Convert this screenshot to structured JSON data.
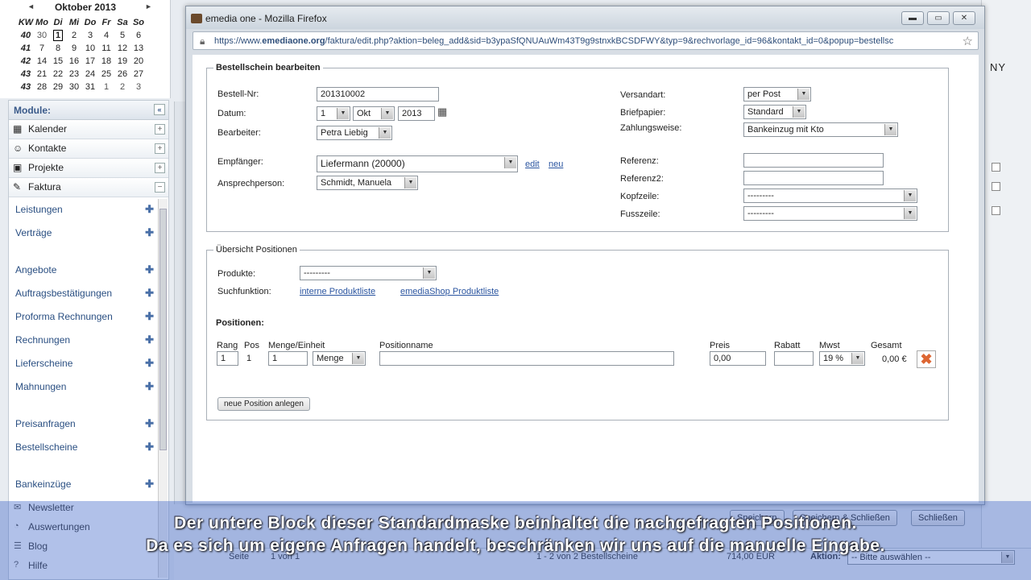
{
  "calendar": {
    "month_label": "Oktober 2013",
    "prev": "◄",
    "next": "►",
    "headers": [
      "KW",
      "Mo",
      "Di",
      "Mi",
      "Do",
      "Fr",
      "Sa",
      "So"
    ],
    "weeks": [
      [
        "40",
        "30",
        "1",
        "2",
        "3",
        "4",
        "5",
        "6"
      ],
      [
        "41",
        "7",
        "8",
        "9",
        "10",
        "11",
        "12",
        "13"
      ],
      [
        "42",
        "14",
        "15",
        "16",
        "17",
        "18",
        "19",
        "20"
      ],
      [
        "43",
        "21",
        "22",
        "23",
        "24",
        "25",
        "26",
        "27"
      ],
      [
        "43",
        "28",
        "29",
        "30",
        "31",
        "1",
        "2",
        "3"
      ]
    ]
  },
  "sidebar": {
    "header": "Module:",
    "collapse": "«",
    "modules": [
      {
        "label": "Kalender",
        "icon": "calendar-icon",
        "toggle": "+"
      },
      {
        "label": "Kontakte",
        "icon": "contacts-icon",
        "toggle": "+"
      },
      {
        "label": "Projekte",
        "icon": "projects-icon",
        "toggle": "+"
      },
      {
        "label": "Faktura",
        "icon": "invoice-icon",
        "toggle": "−"
      }
    ],
    "faktura_items": [
      "Leistungen",
      "Verträge",
      "Angebote",
      "Auftragsbestätigungen",
      "Proforma Rechnungen",
      "Rechnungen",
      "Lieferscheine",
      "Mahnungen",
      "Preisanfragen",
      "Bestellscheine",
      "Bankeinzüge"
    ],
    "lower_items": [
      "Newsletter",
      "Auswertungen",
      "Blog",
      "Hilfe"
    ]
  },
  "browser": {
    "title": "emedia one - Mozilla Firefox",
    "url_prefix": "https://www.",
    "url_domain": "emediaone.org",
    "url_path": "/faktura/edit.php?aktion=beleg_add&sid=b3ypaSfQNUAuWm43T9g9stnxkBCSDFWY&typ=9&rechvorlage_id=96&kontakt_id=0&popup=bestellsc",
    "win_buttons": [
      "▬",
      "▭",
      "✕"
    ]
  },
  "form": {
    "legend": "Bestellschein bearbeiten",
    "bestell_nr_label": "Bestell-Nr:",
    "bestell_nr": "201310002",
    "datum_label": "Datum:",
    "datum_day": "1",
    "datum_month": "Okt",
    "datum_year": "2013",
    "bearbeiter_label": "Bearbeiter:",
    "bearbeiter": "Petra Liebig",
    "empfaenger_label": "Empfänger:",
    "empfaenger": "Liefermann (20000)",
    "edit_link": "edit",
    "neu_link": "neu",
    "ansprech_label": "Ansprechperson:",
    "ansprech": "Schmidt, Manuela",
    "versandart_label": "Versandart:",
    "versandart": "per Post",
    "briefpapier_label": "Briefpapier:",
    "briefpapier": "Standard",
    "zahlungsweise_label": "Zahlungsweise:",
    "zahlungsweise": "Bankeinzug mit Kto",
    "referenz_label": "Referenz:",
    "referenz2_label": "Referenz2:",
    "kopfzeile_label": "Kopfzeile:",
    "kopfzeile": "---------",
    "fusszeile_label": "Fusszeile:",
    "fusszeile": "---------"
  },
  "positions": {
    "legend": "Übersicht Positionen",
    "produkte_label": "Produkte:",
    "produkte": "---------",
    "suche_label": "Suchfunktion:",
    "intern_link": "interne Produktliste",
    "shop_link": "emediaShop Produktliste",
    "positionen_label": "Positionen:",
    "col_rang": "Rang",
    "col_pos": "Pos",
    "col_menge": "Menge/Einheit",
    "col_name": "Positionname",
    "col_preis": "Preis",
    "col_rabatt": "Rabatt",
    "col_mwst": "Mwst",
    "col_gesamt": "Gesamt",
    "row": {
      "rang": "1",
      "pos": "1",
      "menge": "1",
      "einheit": "Menge",
      "name": "",
      "preis": "0,00",
      "rabatt": "",
      "mwst": "19 %",
      "gesamt": "0,00 €"
    },
    "add_button": "neue Position anlegen"
  },
  "footer": {
    "save": "Speichern",
    "save_close": "Speichern & Schließen",
    "close": "Schließen"
  },
  "pager": {
    "seite": "Seite",
    "page_of": "1   von 1",
    "range": "1 - 2 von 2 Bestellscheine",
    "total": "714,00 EUR",
    "aktion_label": "Aktion:",
    "aktion": "-- Bitte auswählen --"
  },
  "background": {
    "right_text": "NY"
  },
  "caption": {
    "line1": "Der untere Block dieser Standardmaske beinhaltet die nachgefragten Positionen.",
    "line2": "Da es sich um eigene Anfragen handelt, beschränken wir uns auf die manuelle Eingabe."
  }
}
